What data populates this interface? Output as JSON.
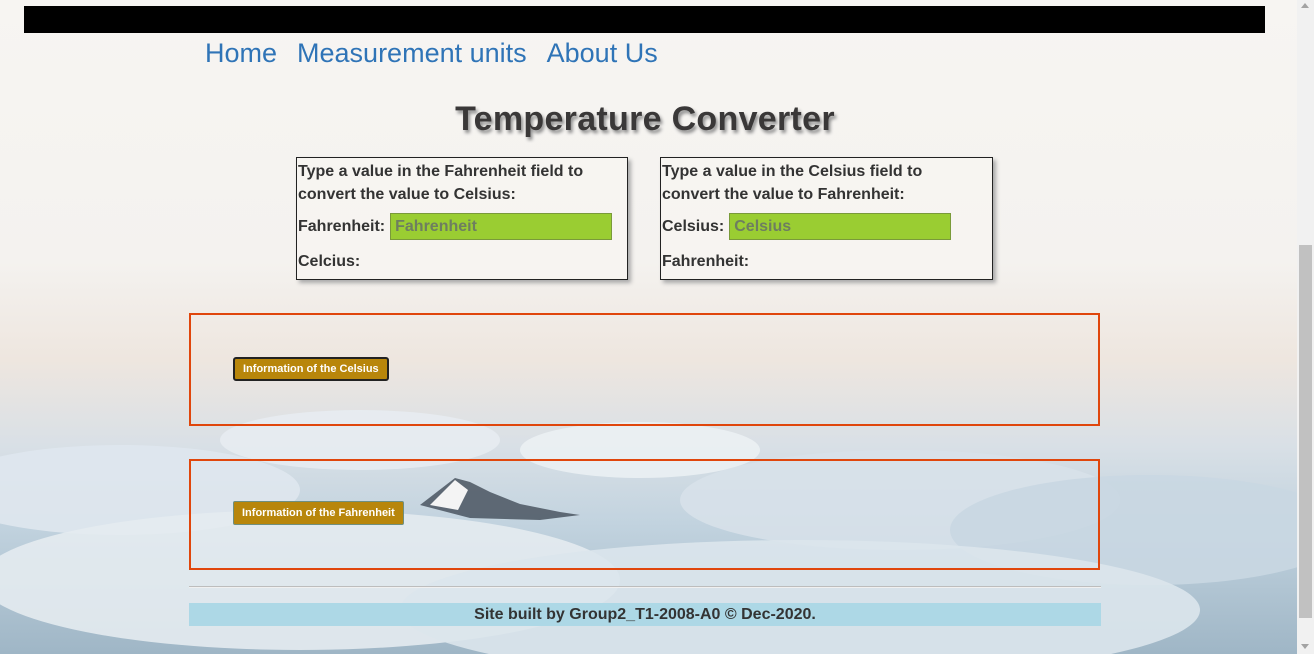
{
  "nav": {
    "items": [
      "Home",
      "Measurement units",
      "About Us"
    ]
  },
  "page_title": "Temperature Converter",
  "converter_f_to_c": {
    "description": "Type a value in the Fahrenheit field to convert the value to Celsius:",
    "input_label": "Fahrenheit:",
    "input_placeholder": "Fahrenheit",
    "input_value": "",
    "result_label": "Celcius:",
    "result_value": ""
  },
  "converter_c_to_f": {
    "description": "Type a value in the Celsius field to convert the value to Fahrenheit:",
    "input_label": "Celsius:",
    "input_placeholder": "Celsius",
    "input_value": "",
    "result_label": "Fahrenheit:",
    "result_value": ""
  },
  "info_buttons": {
    "celsius": "Information of the Celsius",
    "fahrenheit": "Information of the Fahrenheit"
  },
  "footer": {
    "text": "Site built by Group2_T1-2008-A0 © Dec-2020."
  },
  "colors": {
    "nav_link": "#2f74b7",
    "input_bg": "#9acd32",
    "info_border": "#e0460c",
    "info_button": "#b8860b",
    "footer_bg": "#add8e6",
    "top_bar": "#000000"
  }
}
